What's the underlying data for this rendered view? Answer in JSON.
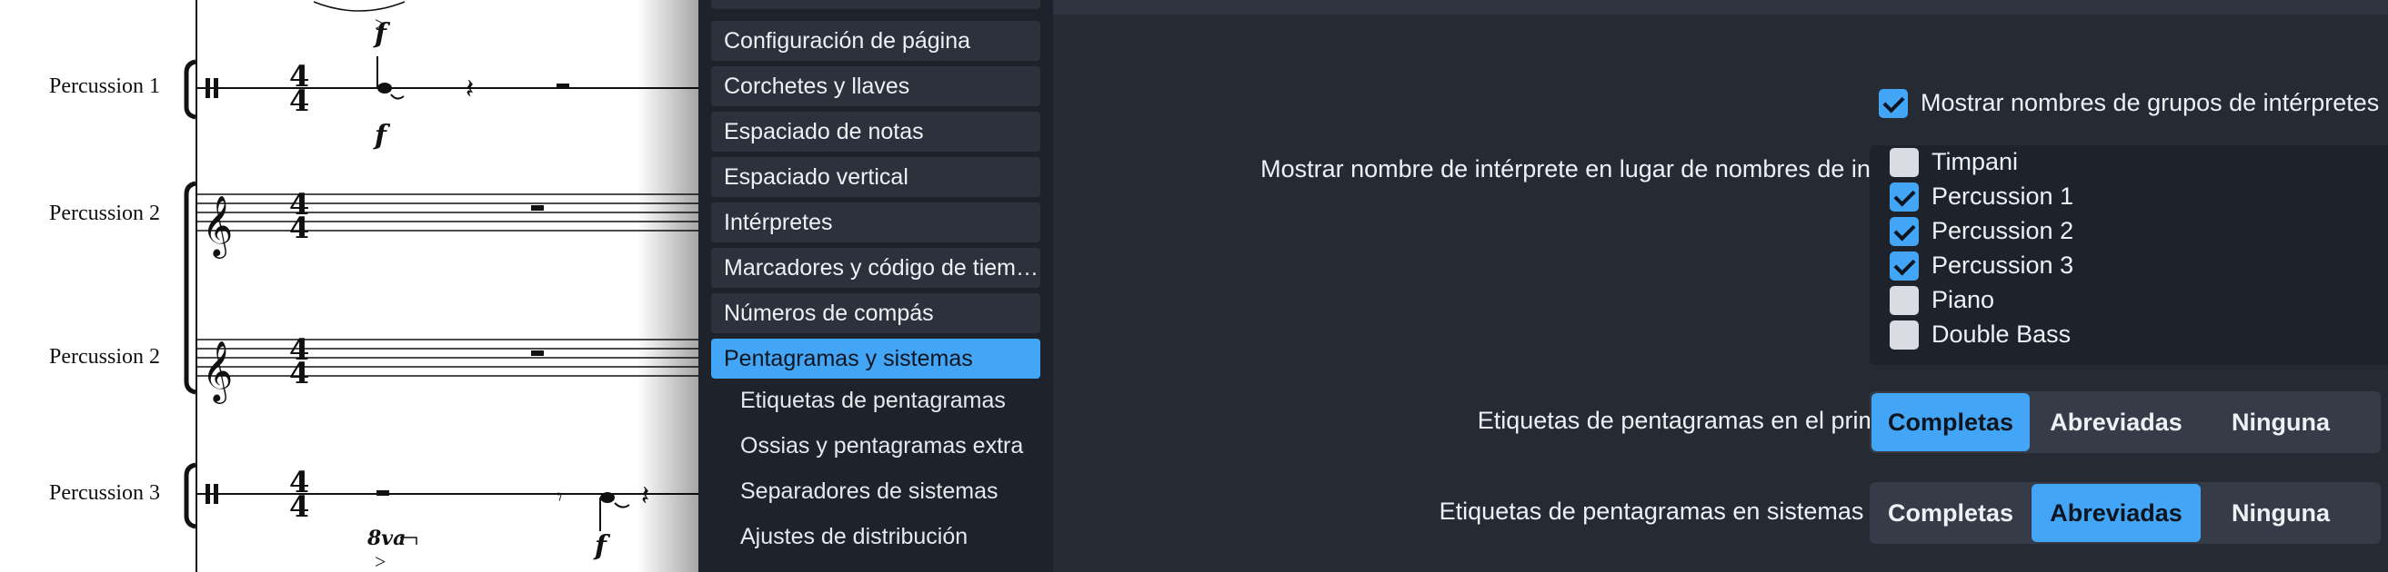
{
  "score": {
    "instruments": [
      {
        "name": "Percussion 1"
      },
      {
        "name": "Percussion 2"
      },
      {
        "name": "Percussion 2"
      },
      {
        "name": "Percussion 3"
      }
    ],
    "dynamics": [
      "f",
      "f",
      "f"
    ],
    "ottava": "8va",
    "time_signature": {
      "top": "4",
      "bottom": "4"
    }
  },
  "sidebar": {
    "items": [
      {
        "label": "Configuración de página",
        "active": false
      },
      {
        "label": "Corchetes y llaves",
        "active": false
      },
      {
        "label": "Espaciado de notas",
        "active": false
      },
      {
        "label": "Espaciado vertical",
        "active": false
      },
      {
        "label": "Intérpretes",
        "active": false
      },
      {
        "label": "Marcadores y código de tiempo",
        "active": false
      },
      {
        "label": "Números de compás",
        "active": false
      },
      {
        "label": "Pentagramas y sistemas",
        "active": true
      }
    ],
    "subitems": [
      {
        "label": "Etiquetas de pentagramas"
      },
      {
        "label": "Ossias y pentagramas extra"
      },
      {
        "label": "Separadores de sistemas"
      },
      {
        "label": "Ajustes de distribución"
      }
    ]
  },
  "panel": {
    "show_group_names": {
      "label": "Mostrar nombres de grupos de intérpretes",
      "checked": true
    },
    "player_names": {
      "label": "Mostrar nombre de intérprete en lugar de nombres de instrumentos:",
      "players": [
        {
          "name": "Timpani",
          "checked": false
        },
        {
          "name": "Percussion 1",
          "checked": true
        },
        {
          "name": "Percussion 2",
          "checked": true
        },
        {
          "name": "Percussion 3",
          "checked": true
        },
        {
          "name": "Piano",
          "checked": false
        },
        {
          "name": "Double Bass",
          "checked": false
        }
      ]
    },
    "first_system": {
      "label": "Etiquetas de pentagramas en el primer sistema:",
      "options": [
        "Completas",
        "Abreviadas",
        "Ninguna"
      ],
      "selected": "Completas"
    },
    "later_systems": {
      "label": "Etiquetas de pentagramas en sistemas posteriores:",
      "options": [
        "Completas",
        "Abreviadas",
        "Ninguna"
      ],
      "selected": "Abreviadas"
    }
  },
  "colors": {
    "accent": "#43a5f5",
    "panel": "#252a33",
    "sidebar": "#1e232b",
    "score_bg": "#ffffff"
  }
}
